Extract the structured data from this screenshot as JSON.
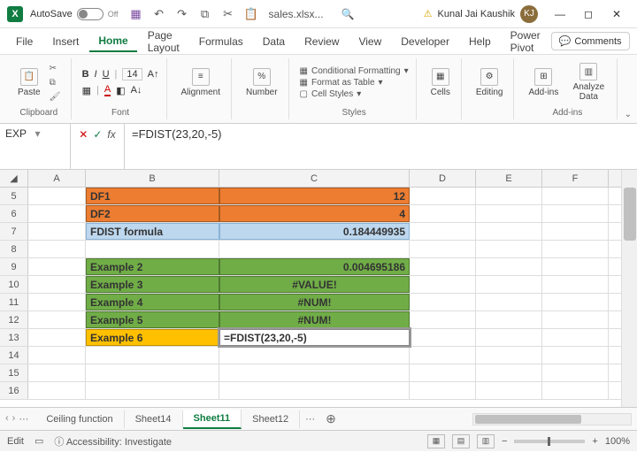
{
  "titlebar": {
    "app_icon_letter": "X",
    "autosave_label": "AutoSave",
    "autosave_state": "Off",
    "doc_name": "sales.xlsx...",
    "user_name": "Kunal Jai Kaushik",
    "user_initials": "KJ"
  },
  "menu": {
    "file": "File",
    "insert": "Insert",
    "home": "Home",
    "page_layout": "Page Layout",
    "formulas": "Formulas",
    "data": "Data",
    "review": "Review",
    "view": "View",
    "developer": "Developer",
    "help": "Help",
    "power_pivot": "Power Pivot",
    "comments": "Comments"
  },
  "ribbon": {
    "paste": "Paste",
    "clipboard": "Clipboard",
    "font": "Font",
    "font_size": "14",
    "alignment": "Alignment",
    "number": "Number",
    "percent": "%",
    "cond_fmt": "Conditional Formatting",
    "as_table": "Format as Table",
    "cell_styles": "Cell Styles",
    "styles": "Styles",
    "cells": "Cells",
    "editing": "Editing",
    "addins": "Add-ins",
    "analyze": "Analyze Data",
    "addins_group": "Add-ins"
  },
  "formula_bar": {
    "name_box": "EXP",
    "fx": "fx",
    "formula": "=FDIST(23,20,-5)"
  },
  "columns": [
    "A",
    "B",
    "C",
    "D",
    "E",
    "F"
  ],
  "rows": [
    {
      "n": "5",
      "b": "DF1",
      "c": "12",
      "style": "orange",
      "c_align": "right"
    },
    {
      "n": "6",
      "b": "DF2",
      "c": "4",
      "style": "orange",
      "c_align": "right"
    },
    {
      "n": "7",
      "b": "FDIST formula",
      "c": "0.184449935",
      "style": "blue",
      "c_align": "right"
    },
    {
      "n": "8",
      "b": "",
      "c": "",
      "style": "",
      "c_align": ""
    },
    {
      "n": "9",
      "b": "Example 2",
      "c": "0.004695186",
      "style": "green",
      "c_align": "right"
    },
    {
      "n": "10",
      "b": "Example 3",
      "c": "#VALUE!",
      "style": "green",
      "c_align": "center"
    },
    {
      "n": "11",
      "b": "Example 4",
      "c": "#NUM!",
      "style": "green",
      "c_align": "center"
    },
    {
      "n": "12",
      "b": "Example 5",
      "c": "#NUM!",
      "style": "green",
      "c_align": "center"
    },
    {
      "n": "13",
      "b": "Example 6",
      "c": "=FDIST(23,20,-5)",
      "style": "amber",
      "c_align": "left",
      "editing": true
    },
    {
      "n": "14",
      "b": "",
      "c": "",
      "style": "",
      "c_align": ""
    },
    {
      "n": "15",
      "b": "",
      "c": "",
      "style": "",
      "c_align": ""
    },
    {
      "n": "16",
      "b": "",
      "c": "",
      "style": "",
      "c_align": ""
    }
  ],
  "sheets": {
    "s1": "Ceiling function",
    "s2": "Sheet14",
    "s3": "Sheet11",
    "s4": "Sheet12"
  },
  "status": {
    "mode": "Edit",
    "accessibility": "Accessibility: Investigate",
    "zoom": "100%"
  }
}
